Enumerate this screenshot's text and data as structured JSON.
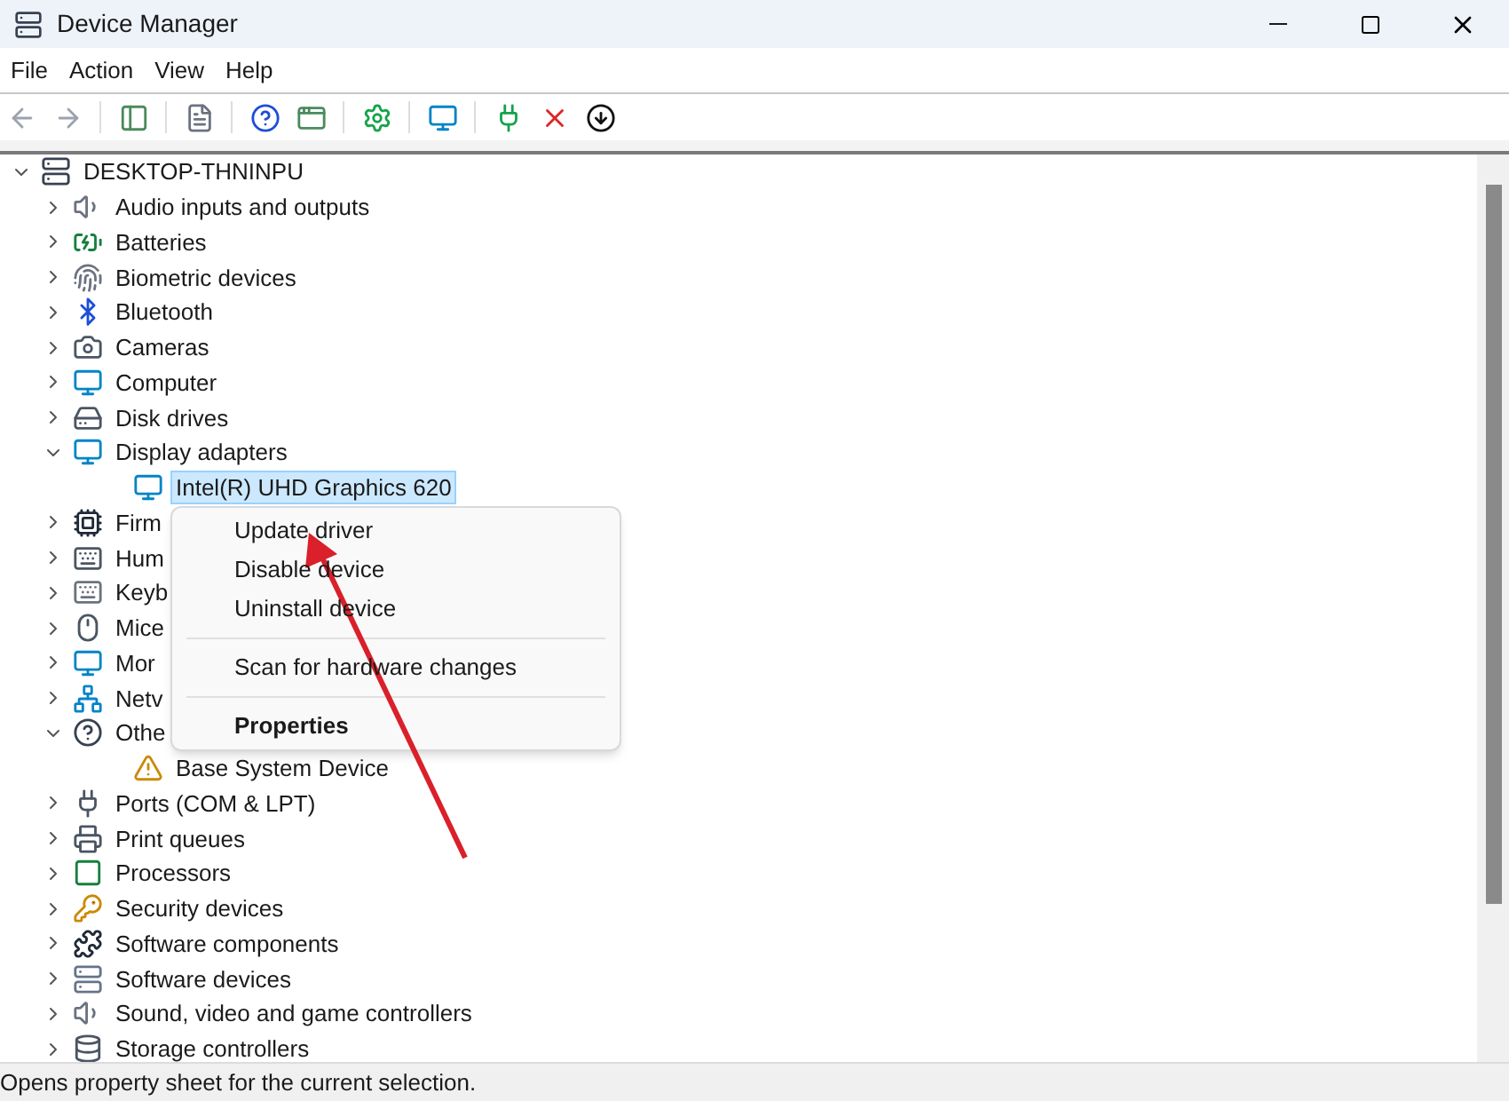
{
  "window": {
    "title": "Device Manager"
  },
  "menu_bar": [
    "File",
    "Action",
    "View",
    "Help"
  ],
  "tree": {
    "label": "DESKTOP-THNINPU",
    "expanded": true,
    "children": [
      {
        "label": "Audio inputs and outputs",
        "expanded": false
      },
      {
        "label": "Batteries",
        "expanded": false
      },
      {
        "label": "Biometric devices",
        "expanded": false
      },
      {
        "label": "Bluetooth",
        "expanded": false
      },
      {
        "label": "Cameras",
        "expanded": false
      },
      {
        "label": "Computer",
        "expanded": false
      },
      {
        "label": "Disk drives",
        "expanded": false
      },
      {
        "label": "Display adapters",
        "expanded": true,
        "children": [
          {
            "label": "Intel(R) UHD Graphics 620",
            "selected": true
          }
        ]
      },
      {
        "label": "Firm",
        "expanded": false
      },
      {
        "label": "Hum",
        "expanded": false
      },
      {
        "label": "Keyb",
        "expanded": false
      },
      {
        "label": "Mice",
        "expanded": false
      },
      {
        "label": "Mor",
        "expanded": false
      },
      {
        "label": "Netv",
        "expanded": false
      },
      {
        "label": "Othe",
        "expanded": true,
        "children": [
          {
            "label": "Base System Device",
            "selected": false
          }
        ]
      },
      {
        "label": "Ports (COM & LPT)",
        "expanded": false
      },
      {
        "label": "Print queues",
        "expanded": false
      },
      {
        "label": "Processors",
        "expanded": false
      },
      {
        "label": "Security devices",
        "expanded": false
      },
      {
        "label": "Software components",
        "expanded": false
      },
      {
        "label": "Software devices",
        "expanded": false
      },
      {
        "label": "Sound, video and game controllers",
        "expanded": false
      },
      {
        "label": "Storage controllers",
        "expanded": false
      }
    ]
  },
  "context_menu": [
    {
      "kind": "item",
      "label": "Update driver",
      "default": false
    },
    {
      "kind": "item",
      "label": "Disable device",
      "default": false
    },
    {
      "kind": "item",
      "label": "Uninstall device",
      "default": false
    },
    {
      "kind": "separator"
    },
    {
      "kind": "item",
      "label": "Scan for hardware changes",
      "default": false
    },
    {
      "kind": "separator"
    },
    {
      "kind": "item",
      "label": "Properties",
      "default": true
    }
  ],
  "status_bar": "Opens property sheet for the current selection."
}
